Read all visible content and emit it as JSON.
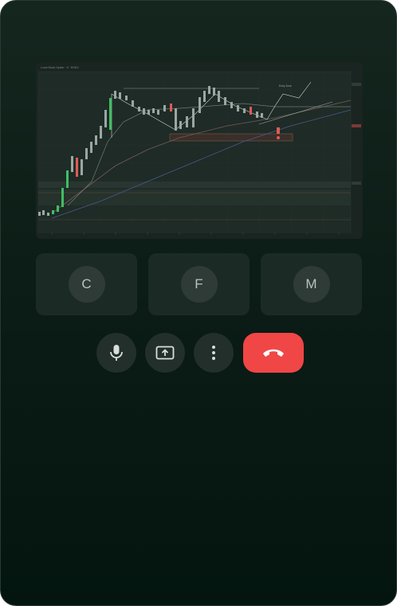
{
  "screen_share": {
    "header_text": "Local Stock Option · H · BXDX",
    "annotation_top": "Entry Zone",
    "alert_glyph": "!"
  },
  "participants": [
    {
      "initial": "C"
    },
    {
      "initial": "F"
    },
    {
      "initial": "M"
    }
  ],
  "controls": {
    "mic_icon": "microphone-icon",
    "share_icon": "present-screen-icon",
    "more_icon": "more-vert-icon",
    "hangup_icon": "call-end-icon"
  },
  "colors": {
    "hangup": "#f04646",
    "candle_up": "#3fbf63",
    "candle_down": "#e05a55"
  }
}
